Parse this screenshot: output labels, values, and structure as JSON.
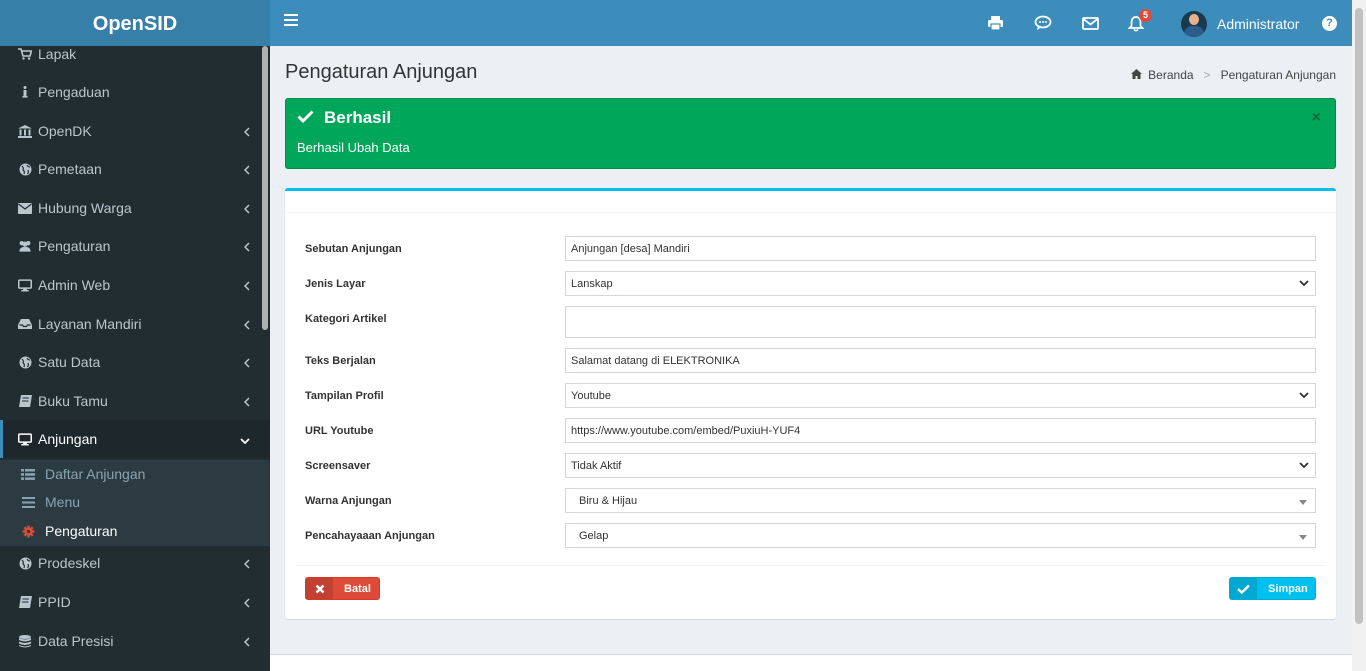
{
  "app": {
    "logo": "OpenSID"
  },
  "topbar": {
    "notification_count": "5",
    "user_name": "Administrator",
    "help_label": "?"
  },
  "sidebar": {
    "items": [
      {
        "label": "Lapak",
        "icon": "cart-icon"
      },
      {
        "label": "Pengaduan",
        "icon": "info-icon"
      },
      {
        "label": "OpenDK",
        "icon": "institution-icon"
      },
      {
        "label": "Pemetaan",
        "icon": "globe-icon"
      },
      {
        "label": "Hubung Warga",
        "icon": "envelope-icon"
      },
      {
        "label": "Pengaturan",
        "icon": "users-icon"
      },
      {
        "label": "Admin Web",
        "icon": "desktop-icon"
      },
      {
        "label": "Layanan Mandiri",
        "icon": "inbox-icon"
      },
      {
        "label": "Satu Data",
        "icon": "globe-icon"
      },
      {
        "label": "Buku Tamu",
        "icon": "book-icon"
      },
      {
        "label": "Anjungan",
        "icon": "desktop-icon"
      },
      {
        "label": "Prodeskel",
        "icon": "globe-icon"
      },
      {
        "label": "PPID",
        "icon": "book-icon"
      },
      {
        "label": "Data Presisi",
        "icon": "database-icon"
      }
    ],
    "submenu": [
      {
        "label": "Daftar Anjungan",
        "icon": "list-icon"
      },
      {
        "label": "Menu",
        "icon": "bars-icon"
      },
      {
        "label": "Pengaturan",
        "icon": "gear-icon"
      }
    ]
  },
  "page": {
    "title": "Pengaturan Anjungan",
    "breadcrumb": {
      "home": "Beranda",
      "current": "Pengaturan Anjungan"
    }
  },
  "alert": {
    "title": "Berhasil",
    "message": "Berhasil Ubah Data",
    "close": "×"
  },
  "form": {
    "fields": [
      {
        "label": "Sebutan Anjungan",
        "value": "Anjungan [desa] Mandiri",
        "type": "text"
      },
      {
        "label": "Jenis Layar",
        "value": "Lanskap",
        "type": "select"
      },
      {
        "label": "Kategori Artikel",
        "value": "",
        "type": "multiselect"
      },
      {
        "label": "Teks Berjalan",
        "value": "Salamat datang di ELEKTRONIKA",
        "type": "text"
      },
      {
        "label": "Tampilan Profil",
        "value": "Youtube",
        "type": "select"
      },
      {
        "label": "URL Youtube",
        "value": "https://www.youtube.com/embed/PuxiuH-YUF4",
        "type": "text"
      },
      {
        "label": "Screensaver",
        "value": "Tidak Aktif",
        "type": "select"
      },
      {
        "label": "Warna Anjungan",
        "value": "Biru & Hijau",
        "type": "select2"
      },
      {
        "label": "Pencahayaaan Anjungan",
        "value": "Gelap",
        "type": "select2"
      }
    ],
    "cancel_label": "Batal",
    "save_label": "Simpan"
  },
  "colors": {
    "header": "#3c8dbc",
    "logo_bg": "#367fa9",
    "sidebar": "#222d32",
    "success": "#00a65a",
    "info": "#00c0ef",
    "danger": "#dd4b39"
  }
}
